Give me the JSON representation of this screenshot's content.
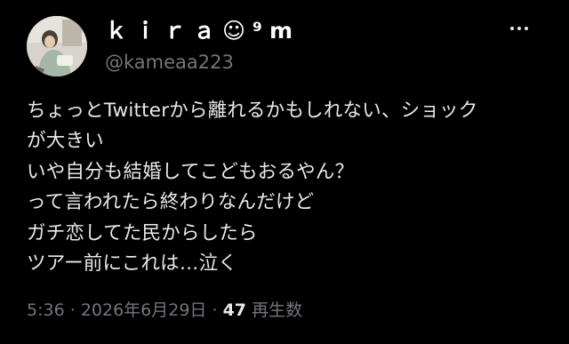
{
  "user": {
    "display_name": "ｋｉｒａ☺︎⁹m",
    "handle": "@kameaa223",
    "avatar_icon": "profile-photo"
  },
  "tweet": {
    "lines": [
      "ちょっとTwitterから離れるかもしれない、ショック",
      "が大きい",
      "いや自分も結婚してこどもおるやん？",
      "って言われたら終わりなんだけど",
      "ガチ恋してた民からしたら",
      "ツアー前にこれは…泣く"
    ]
  },
  "meta": {
    "time": "5:36",
    "separator": "·",
    "date": "2026年6月29日",
    "views_count": "47",
    "views_label": "再生数"
  },
  "more_icon": "more-horizontal-icon",
  "colors": {
    "background": "#000000",
    "primary_text": "#e7e9ea",
    "secondary_text": "#71767b"
  }
}
